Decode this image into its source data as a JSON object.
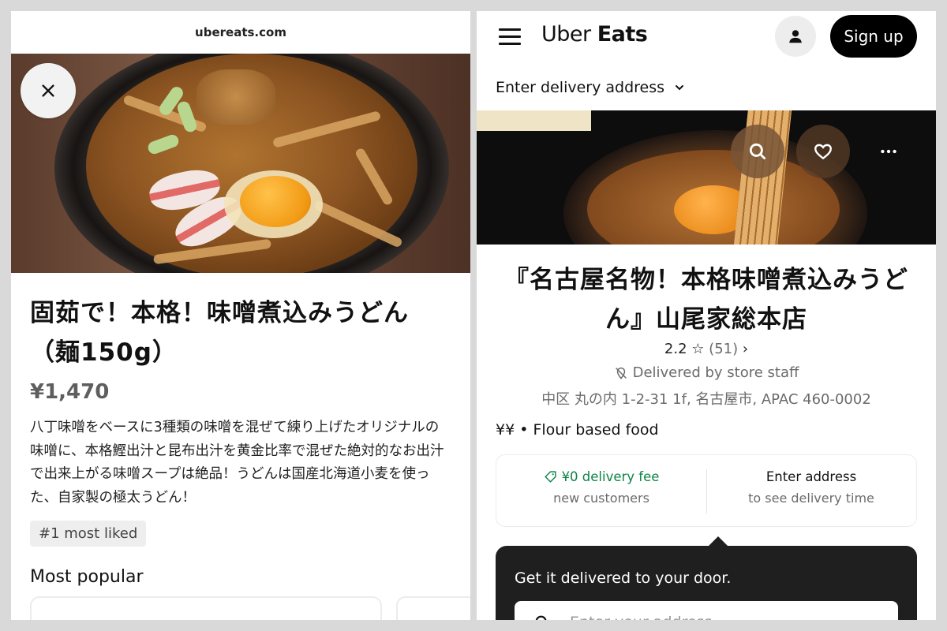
{
  "left": {
    "url": "ubereats.com",
    "item_title": "固茹で！本格！味噌煮込みうどん（麺150g）",
    "price": "¥1,470",
    "description": "八丁味噌をベースに3種類の味噌を混ぜて練り上げたオリジナルの味噌に、本格鰹出汁と昆布出汁を黄金比率で混ぜた絶対的なお出汁で出来上がる味噌スープは絶品！うどんは国産北海道小麦を使った、自家製の極太うどん！",
    "badge": "#1 most liked",
    "section_title": "Most popular",
    "icons": {
      "close": "close-icon"
    }
  },
  "right": {
    "brand": {
      "part1": "Uber",
      "part2": "Eats"
    },
    "signup_label": "Sign up",
    "address_prompt": "Enter delivery address",
    "restaurant_name": "『名古屋名物！本格味噌煮込みうどん』山尾家総本店",
    "rating": "2.2",
    "rating_count": "(51)",
    "delivery_note": "Delivered by store staff",
    "address": "中区 丸の内 1-2-31 1f, 名古屋市, APAC 460-0002",
    "tags": "¥¥ • Flour based food",
    "fee": {
      "main": "¥0 delivery fee",
      "sub": "new customers"
    },
    "eta": {
      "main": "Enter address",
      "sub": "to see delivery time"
    },
    "tooltip": {
      "text": "Get it delivered to your door.",
      "placeholder": "Enter your address"
    },
    "icons": {
      "menu": "hamburger-menu-icon",
      "user": "user-icon",
      "search": "search-icon",
      "favorite": "heart-icon",
      "more": "more-icon"
    }
  },
  "colors": {
    "accent_green": "#0e8345",
    "black": "#000000",
    "muted": "#6b6b6b"
  }
}
